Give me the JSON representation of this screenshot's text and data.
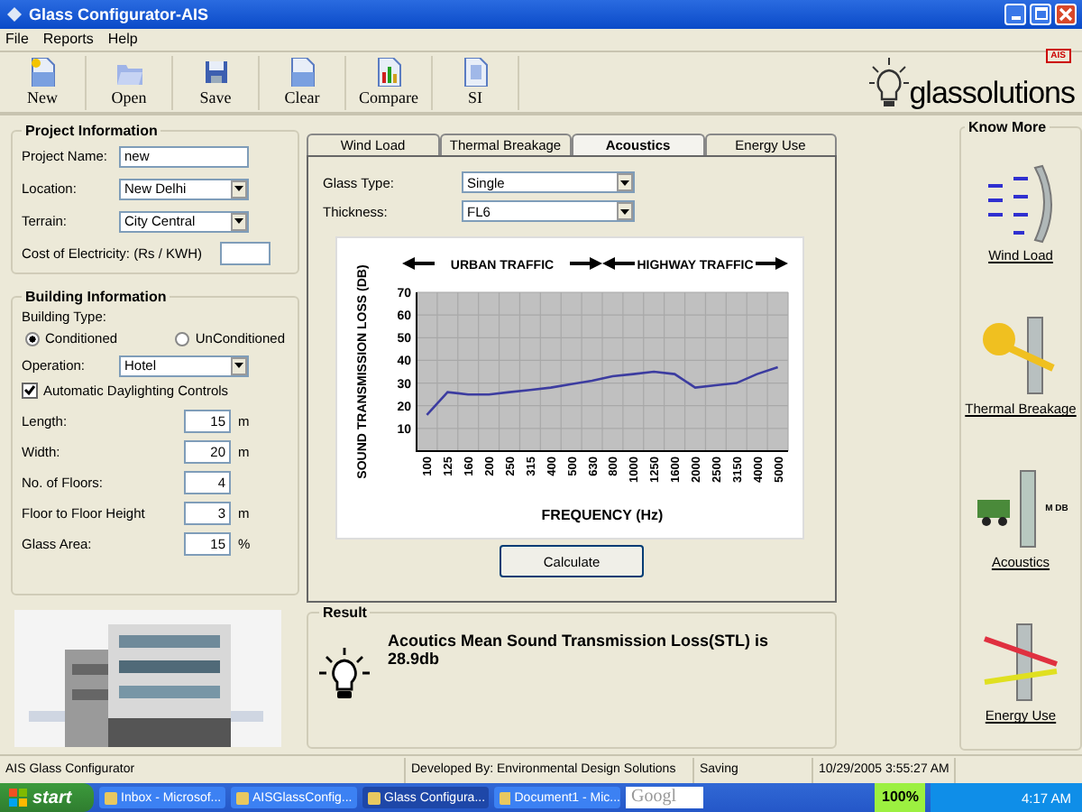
{
  "window": {
    "title": "Glass Configurator-AIS"
  },
  "menu": [
    "File",
    "Reports",
    "Help"
  ],
  "toolbar": [
    {
      "label": "New"
    },
    {
      "label": "Open"
    },
    {
      "label": "Save"
    },
    {
      "label": "Clear"
    },
    {
      "label": "Compare"
    },
    {
      "label": "SI"
    }
  ],
  "logo": {
    "text": "glassolutions",
    "badge": "AIS"
  },
  "project_info": {
    "title": "Project Information",
    "fields": [
      {
        "label": "Project Name:",
        "kind": "text",
        "value": "new"
      },
      {
        "label": "Location:",
        "kind": "select",
        "value": "New Delhi"
      },
      {
        "label": "Terrain:",
        "kind": "select",
        "value": "City Central"
      },
      {
        "label": "Cost of Electricity: (Rs / KWH)",
        "kind": "text"
      }
    ]
  },
  "building_info": {
    "title": "Building Information",
    "type_label": "Building Type:",
    "radios": [
      {
        "label": "Conditioned",
        "selected": true
      },
      {
        "label": "UnConditioned",
        "selected": false
      }
    ],
    "operation": {
      "label": "Operation:",
      "value": "Hotel"
    },
    "daylighting": {
      "label": "Automatic Daylighting Controls",
      "checked": true
    },
    "fields": [
      {
        "label": "Length:",
        "value": "15",
        "unit": "m"
      },
      {
        "label": "Width:",
        "value": "20",
        "unit": "m"
      },
      {
        "label": "No. of Floors:",
        "value": "4"
      },
      {
        "label": "Floor to Floor Height",
        "value": "3",
        "unit": "m"
      },
      {
        "label": "Glass Area:",
        "value": "15",
        "unit": "%"
      }
    ]
  },
  "tabs": [
    {
      "label": "Wind Load",
      "selected": false
    },
    {
      "label": "Thermal Breakage",
      "selected": false
    },
    {
      "label": "Acoustics",
      "selected": true
    },
    {
      "label": "Energy Use",
      "selected": false
    }
  ],
  "acoustics": {
    "fields": [
      {
        "label": "Glass Type:",
        "value": "Single"
      },
      {
        "label": "Thickness:",
        "value": "FL6"
      }
    ],
    "chart_data": {
      "type": "line",
      "xlabel": "FREQUENCY (Hz)",
      "ylabel": "SOUND TRANSMISSION LOSS (DB)",
      "categories": [
        "100",
        "125",
        "160",
        "200",
        "250",
        "315",
        "400",
        "500",
        "630",
        "800",
        "1000",
        "1250",
        "1600",
        "2000",
        "2500",
        "3150",
        "4000",
        "5000"
      ],
      "grid": true,
      "series": [
        {
          "color": "#3c3ca0",
          "values": [
            16,
            26,
            25,
            25,
            26,
            27,
            28,
            29.5,
            31,
            33,
            34,
            35,
            34,
            28,
            29,
            30,
            34,
            37
          ]
        }
      ],
      "ylim": [
        0,
        70
      ],
      "yticks": [
        10,
        20,
        30,
        40,
        50,
        60,
        70
      ],
      "annotations": [
        {
          "text": "URBAN TRAFFIC"
        },
        {
          "text": "HIGHWAY TRAFFIC"
        }
      ]
    },
    "calculate": "Calculate"
  },
  "result": {
    "title": "Result",
    "text": "Acoutics Mean Sound Transmission Loss(STL) is 28.9db"
  },
  "know_more": {
    "title": "Know More",
    "items": [
      {
        "label": "Wind Load"
      },
      {
        "label": "Thermal Breakage"
      },
      {
        "label": "Acoustics",
        "badge": "M DB"
      },
      {
        "label": "Energy Use"
      }
    ]
  },
  "status_bar": [
    "AIS Glass Configurator",
    "Developed By: Environmental Design Solutions",
    "Saving",
    "10/29/2005 3:55:27 AM"
  ],
  "taskbar": {
    "start": "start",
    "items": [
      {
        "label": "Inbox - Microsof...",
        "selected": false
      },
      {
        "label": "AISGlassConfig...",
        "selected": false
      },
      {
        "label": "Glass Configura...",
        "selected": true
      },
      {
        "label": "Document1 - Mic...",
        "selected": false
      }
    ],
    "search": "Googl",
    "zoom": "100%",
    "clock": "4:17 AM"
  }
}
